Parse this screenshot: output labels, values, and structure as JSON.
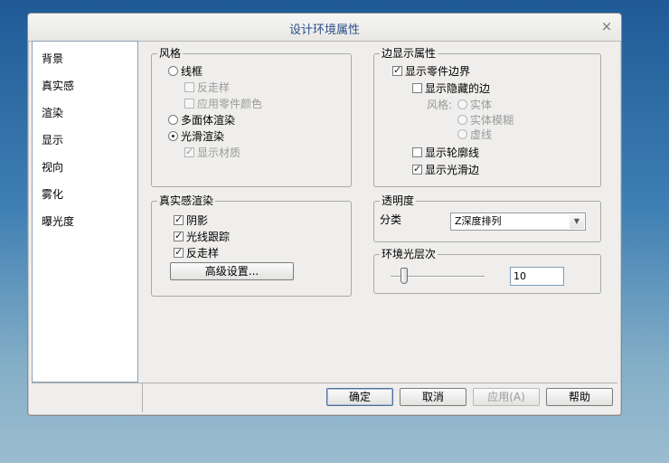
{
  "dialog": {
    "title": "设计环境属性",
    "close_glyph": "×"
  },
  "nav": {
    "items": [
      {
        "label": "背景"
      },
      {
        "label": "真实感"
      },
      {
        "label": "渲染"
      },
      {
        "label": "显示"
      },
      {
        "label": "视向"
      },
      {
        "label": "雾化"
      },
      {
        "label": "曝光度"
      }
    ]
  },
  "style_group": {
    "legend": "风格",
    "wireframe": {
      "label": "线框",
      "checked": false
    },
    "antialias": {
      "label": "反走样",
      "checked": false,
      "enabled": false
    },
    "use_part_color": {
      "label": "应用零件颜色",
      "checked": false,
      "enabled": false
    },
    "polygon_render": {
      "label": "多面体渲染",
      "checked": false
    },
    "smooth_render": {
      "label": "光滑渲染",
      "checked": true
    },
    "show_material": {
      "label": "显示材质",
      "checked": true,
      "enabled": false
    }
  },
  "edge_group": {
    "legend": "边显示属性",
    "show_part_edges": {
      "label": "显示零件边界",
      "checked": true
    },
    "show_hidden_edges": {
      "label": "显示隐藏的边",
      "checked": false
    },
    "style_label": "风格:",
    "style_solid": {
      "label": "实体"
    },
    "style_blur": {
      "label": "实体模糊"
    },
    "style_dashed": {
      "label": "虚线"
    },
    "show_silhouette": {
      "label": "显示轮廓线",
      "checked": false
    },
    "show_smooth_edges": {
      "label": "显示光滑边",
      "checked": true
    }
  },
  "realism_group": {
    "legend": "真实感渲染",
    "shadow": {
      "label": "阴影",
      "checked": true
    },
    "raytrace": {
      "label": "光线跟踪",
      "checked": true
    },
    "antialias": {
      "label": "反走样",
      "checked": true
    },
    "advanced_button": "高级设置..."
  },
  "transparency_group": {
    "legend": "透明度",
    "sort_label": "分类",
    "sort_value": "Z深度排列"
  },
  "ambient_group": {
    "legend": "环境光层次",
    "level": 10,
    "level_text": "10"
  },
  "buttons": {
    "ok": "确定",
    "cancel": "取消",
    "apply": "应用(A)",
    "help": "帮助"
  },
  "colors": {
    "desktop_top": "#1f5a96",
    "desktop_bottom": "#9bbccf",
    "dialog_bg": "#efeeec",
    "title_text": "#2b4f8a",
    "disabled_text": "#9a9a9a"
  }
}
